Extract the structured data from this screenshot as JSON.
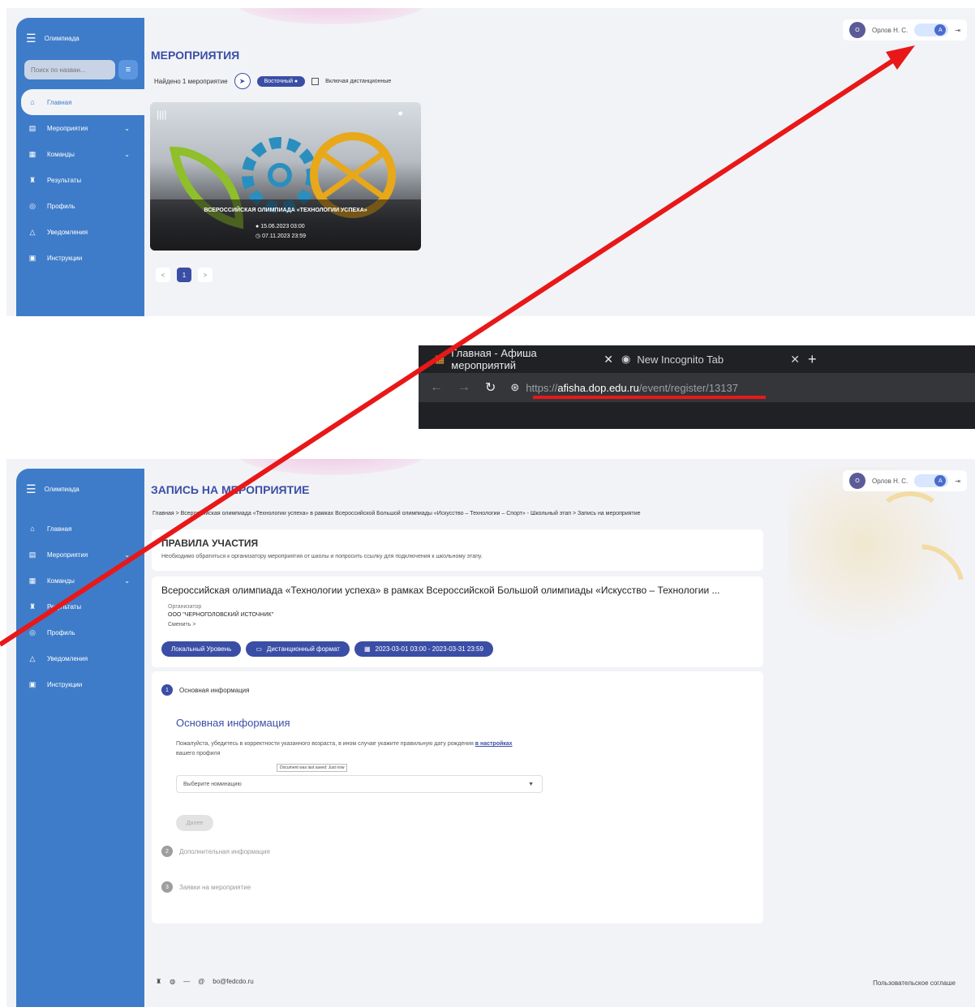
{
  "colors": {
    "sidebar": "#3e7cc9",
    "accent": "#3b4ea6",
    "annotation": "#e81818",
    "browser_bg": "#202124"
  },
  "top": {
    "sidebar": {
      "title": "Олимпиада",
      "search_placeholder": "Поиск по назван...",
      "items": [
        {
          "label": "Главная",
          "icon": "home-icon"
        },
        {
          "label": "Мероприятия",
          "icon": "calendar-icon"
        },
        {
          "label": "Команды",
          "icon": "team-icon"
        },
        {
          "label": "Результаты",
          "icon": "trophy-icon"
        },
        {
          "label": "Профиль",
          "icon": "profile-icon"
        },
        {
          "label": "Уведомления",
          "icon": "bell-icon"
        },
        {
          "label": "Инструкции",
          "icon": "book-icon"
        }
      ]
    },
    "user": {
      "initial": "О",
      "name": "Орлов Н. С.",
      "toggle": "A"
    },
    "page_title": "МЕРОПРИЯТИЯ",
    "found": "Найдено 1 мероприятие",
    "region": "Восточный",
    "remote_label": "Включая дистанционные",
    "card": {
      "title": "ВСЕРОССИЙСКАЯ ОЛИМПИАДА «ТЕХНОЛОГИИ УСПЕХА»",
      "date_start": "15.06.2023 03:00",
      "date_end": "07.11.2023 23:59"
    },
    "pager": {
      "prev": "<",
      "current": "1",
      "next": ">"
    }
  },
  "browser": {
    "tab1": "Главная - Афиша мероприятий",
    "tab2": "New Incognito Tab",
    "url_scheme": "https://",
    "url_host": "afisha.dop.edu.ru",
    "url_path": "/event/register/13137"
  },
  "bottom": {
    "page_title": "ЗАПИСЬ НА МЕРОПРИЯТИЕ",
    "breadcrumb": "Главная   >   Всероссийская олимпиада «Технологии успеха» в рамках Всероссийской Большой олимпиады «Искусство – Технологии – Спорт» - Школьный этап   >   Запись на мероприятие",
    "rules_title": "ПРАВИЛА УЧАСТИЯ",
    "rules_text": "Необходимо обратиться к организатору мероприятия от школы и попросить ссылку для подключения к школьному этапу.",
    "event_title": "Всероссийская олимпиада «Технологии успеха» в рамках Всероссийской Большой олимпиады «Искусство – Технологии ...",
    "organizer_label": "Организатор",
    "organizer_name": "ООО \"ЧЕРНОГОЛОВСКИЙ ИСТОЧНИК\"",
    "organizer_change": "Сменить >",
    "badge_level": "Локальный Уровень",
    "badge_format": "Дистанционный формат",
    "badge_dates": "2023-03-01 03:00 - 2023-03-31 23:59",
    "step1": "Основная информация",
    "form_title": "Основная информация",
    "form_text_1": "Пожалуйста, убедитесь в корректности указанного возраста, в ином случае укажите правильную дату рождения ",
    "form_link": "в настройках",
    "form_text_2": " вашего профиля",
    "tooltip": "Document was last saved: Just now",
    "select_placeholder": "Выберите номинацию",
    "next_button": "Далее",
    "step2": "Дополнительная информация",
    "step3": "Заявки на мероприятие",
    "email": "bo@fedcdo.ru",
    "agreement": "Пользовательское соглаше"
  }
}
